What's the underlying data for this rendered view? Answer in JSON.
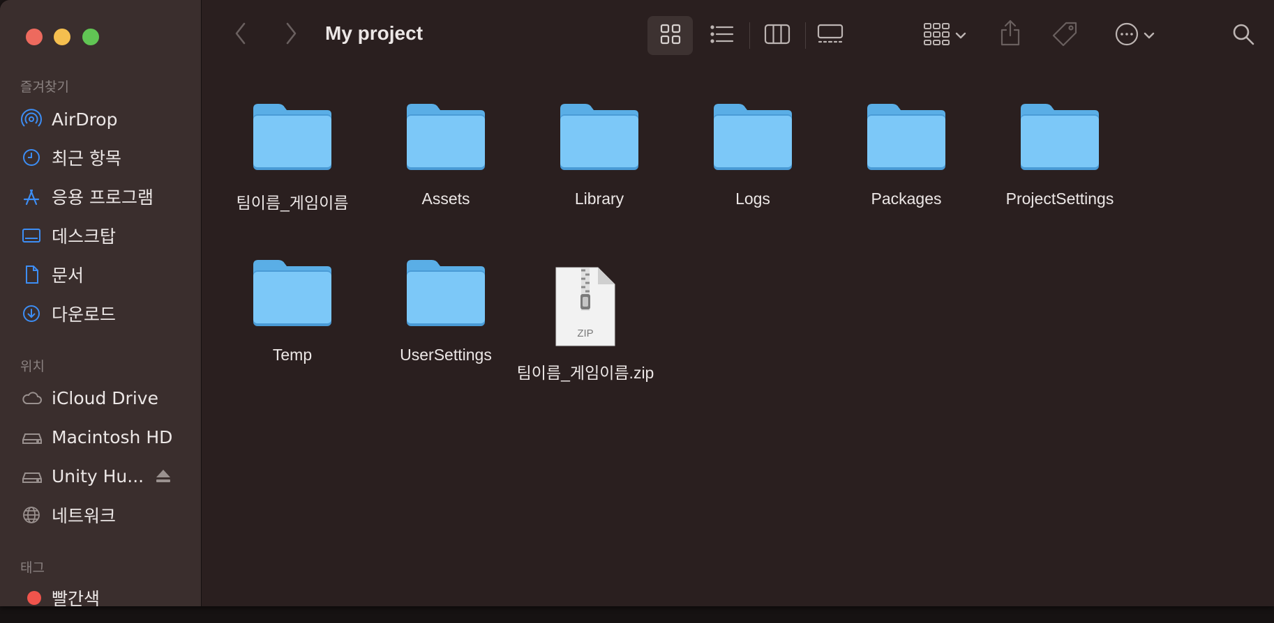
{
  "window": {
    "title": "My project"
  },
  "sidebar": {
    "favorites_header": "즐겨찾기",
    "favorites": [
      {
        "label": "AirDrop",
        "icon": "airdrop-icon"
      },
      {
        "label": "최근 항목",
        "icon": "clock-icon"
      },
      {
        "label": "응용 프로그램",
        "icon": "applications-icon"
      },
      {
        "label": "데스크탑",
        "icon": "desktop-icon"
      },
      {
        "label": "문서",
        "icon": "document-icon"
      },
      {
        "label": "다운로드",
        "icon": "download-icon"
      }
    ],
    "locations_header": "위치",
    "locations": [
      {
        "label": "iCloud Drive",
        "icon": "cloud-icon"
      },
      {
        "label": "Macintosh HD",
        "icon": "drive-icon"
      },
      {
        "label": "Unity Hu...",
        "icon": "drive-icon"
      },
      {
        "label": "네트워크",
        "icon": "globe-icon"
      }
    ],
    "tags_header": "태그",
    "tags": [
      {
        "label": "빨간색",
        "color": "#f0544c"
      }
    ]
  },
  "items": [
    {
      "name": "팀이름_게임이름",
      "kind": "folder"
    },
    {
      "name": "Assets",
      "kind": "folder"
    },
    {
      "name": "Library",
      "kind": "folder"
    },
    {
      "name": "Logs",
      "kind": "folder"
    },
    {
      "name": "Packages",
      "kind": "folder"
    },
    {
      "name": "ProjectSettings",
      "kind": "folder"
    },
    {
      "name": "Temp",
      "kind": "folder"
    },
    {
      "name": "UserSettings",
      "kind": "folder"
    },
    {
      "name": "팀이름_게임이름.zip",
      "kind": "zip",
      "badge": "ZIP"
    }
  ],
  "colors": {
    "accent": "#3d8ef5",
    "folder": "#7cc8f8",
    "folder_tab": "#5aaee6"
  }
}
